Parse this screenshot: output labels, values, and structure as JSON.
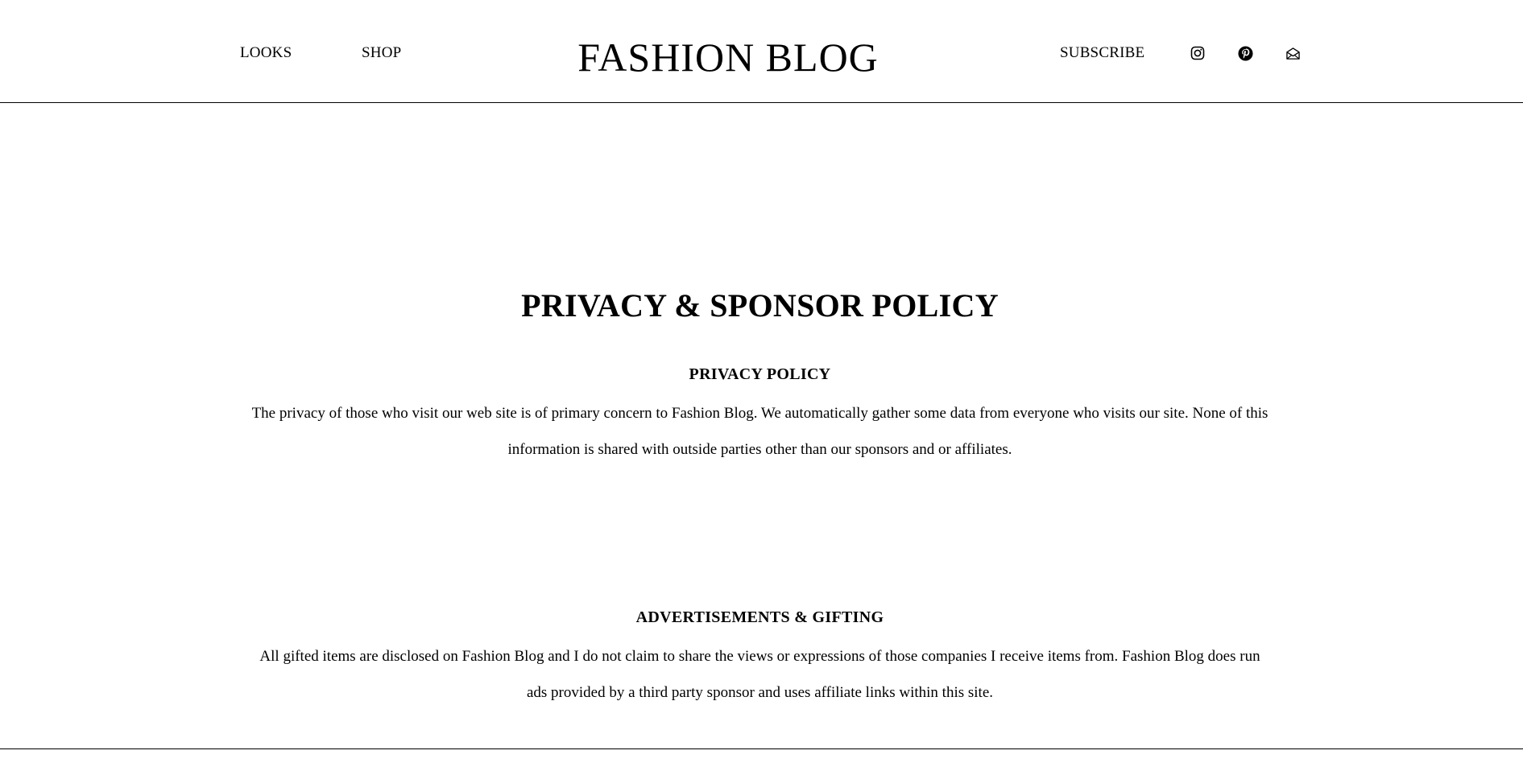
{
  "header": {
    "nav_left": {
      "looks": "LOOKS",
      "shop": "SHOP"
    },
    "logo": "FASHION BLOG",
    "nav_right": {
      "subscribe": "SUBSCRIBE"
    },
    "social_icons": [
      "instagram-icon",
      "pinterest-icon",
      "email-icon"
    ]
  },
  "main": {
    "title": "PRIVACY & SPONSOR POLICY",
    "sections": [
      {
        "heading": "PRIVACY POLICY",
        "body": "The privacy of those who visit our web site is of primary concern to Fashion Blog. We automatically gather some data from everyone who visits our site. None of this information is shared with outside parties other than our sponsors and or affiliates."
      },
      {
        "heading": "ADVERTISEMENTS & GIFTING",
        "body": "All gifted items are disclosed on Fashion Blog and I do not claim to share the views or expressions of those companies I receive items from. Fashion Blog does run ads provided by a third party sponsor and uses affiliate links within this site."
      }
    ]
  },
  "colors": {
    "background": "#ffffff",
    "text": "#000000",
    "divider": "#000000"
  }
}
